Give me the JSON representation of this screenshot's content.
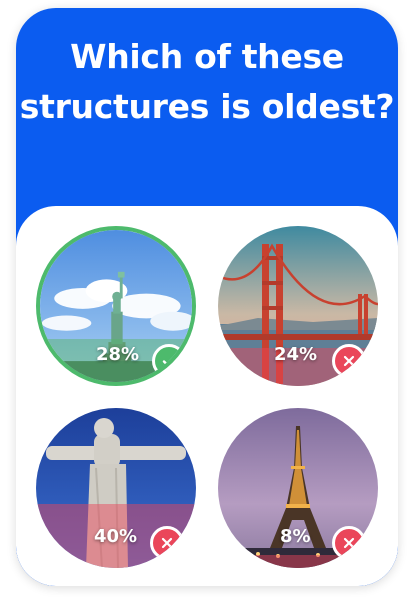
{
  "quiz": {
    "question": "Which of these structures is oldest?",
    "colors": {
      "header": "#0b5cf0",
      "correct": "#4dba6c",
      "wrong": "#ea465a"
    },
    "options": [
      {
        "image": "statue-of-liberty",
        "percent": "28%",
        "share": 0.28,
        "result": "correct",
        "status_icon": "check-icon"
      },
      {
        "image": "golden-gate-bridge",
        "percent": "24%",
        "share": 0.24,
        "result": "wrong",
        "status_icon": "close-icon"
      },
      {
        "image": "christ-the-redeemer",
        "percent": "40%",
        "share": 0.4,
        "result": "wrong",
        "status_icon": "close-icon"
      },
      {
        "image": "eiffel-tower",
        "percent": "8%",
        "share": 0.08,
        "result": "wrong",
        "status_icon": "close-icon"
      }
    ]
  }
}
